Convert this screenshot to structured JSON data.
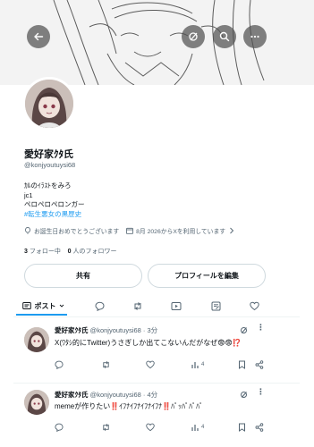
{
  "header": {
    "back_icon": "arrow-left-icon",
    "grok_icon": "grok-icon",
    "search_icon": "search-icon",
    "more_icon": "more-horizontal-icon"
  },
  "profile": {
    "name": "愛好家ｸﾀ氏",
    "handle": "@konjyoutuysi68",
    "bio_line1": "ｶﾙのｲﾗｽﾄをみろ",
    "bio_line2": "jc1",
    "bio_line3": "ペロペロペロンガー",
    "bio_hashtag": "#転生悪女の黒歴史",
    "birthday": "お誕生日おめでとうございます",
    "joined": "8月 2026からXを利用しています",
    "following_count": "3",
    "following_label": "フォロー中",
    "followers_count": "0",
    "followers_label": "人のフォロワー"
  },
  "buttons": {
    "share": "共有",
    "edit_profile": "プロフィールを編集"
  },
  "tabs": {
    "posts": "ポスト"
  },
  "posts": [
    {
      "name": "愛好家ｸﾀ氏",
      "meta": "@konjyoutuysi68 · 3分",
      "text": "X(ﾜﾀｼ的にTwitter)うさぎしか出てこないんだがなぜ😨😨⁉️",
      "views": "4"
    },
    {
      "name": "愛好家ｸﾀ氏",
      "meta": "@konjyoutuysi68 · 4分",
      "text": "memeが作りたい‼️ｲﾌﾅｲﾌﾅｲﾌﾅｲﾌﾅ‼️ﾊﾟｯﾊﾟﾊﾟﾊﾟ",
      "views": "4"
    }
  ],
  "colors": {
    "accent": "#1d9bf0",
    "text": "#0f1419",
    "muted": "#536471"
  }
}
